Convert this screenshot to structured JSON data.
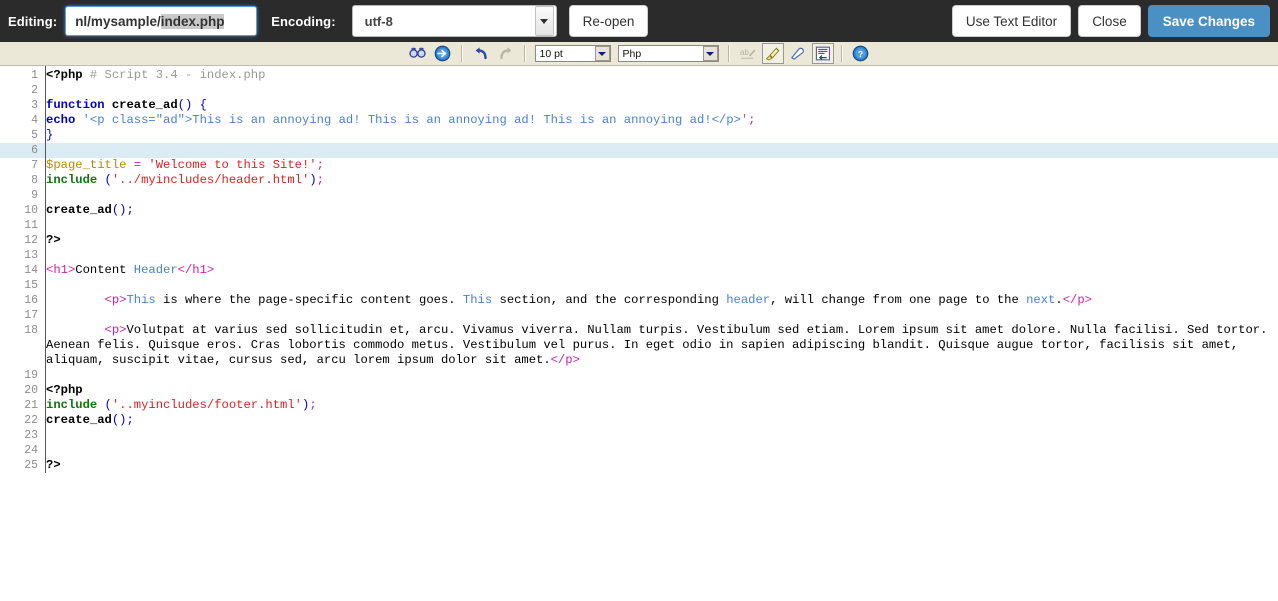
{
  "topbar": {
    "editing_label": "Editing:",
    "filename_prefix": "nl/mysample/",
    "filename_selected": "index.php",
    "encoding_label": "Encoding:",
    "encoding_value": "utf-8",
    "reopen_label": "Re-open",
    "use_text_editor_label": "Use Text Editor",
    "close_label": "Close",
    "save_changes_label": "Save Changes",
    "bar_color": "#2b2b2b",
    "primary_color": "#4a90c4"
  },
  "editor_toolbar": {
    "background": "#ebe8d8",
    "font_size_value": "10 pt",
    "language_value": "Php",
    "icons": [
      "find-icon",
      "goto-line-icon",
      "undo-icon",
      "redo-icon",
      "spellcheck-icon",
      "highlight-icon",
      "eraser-icon",
      "wordwrap-icon",
      "help-icon"
    ]
  },
  "editor": {
    "highlighted_line": 6,
    "total_lines": 25,
    "lines": [
      {
        "n": 1
      },
      {
        "n": 2
      },
      {
        "n": 3
      },
      {
        "n": 4
      },
      {
        "n": 5
      },
      {
        "n": 6
      },
      {
        "n": 7
      },
      {
        "n": 8
      },
      {
        "n": 9
      },
      {
        "n": 10
      },
      {
        "n": 11
      },
      {
        "n": 12
      },
      {
        "n": 13
      },
      {
        "n": 14
      },
      {
        "n": 15
      },
      {
        "n": 16
      },
      {
        "n": 17
      },
      {
        "n": 18
      },
      {
        "n": 19
      },
      {
        "n": 20
      },
      {
        "n": 21
      },
      {
        "n": 22
      },
      {
        "n": 23
      },
      {
        "n": 24
      },
      {
        "n": 25
      }
    ],
    "text": {
      "l1_open": "<?php",
      "l1_comment": " # Script 3.4 - index.php",
      "l3_kw": "function",
      "l3_name": " create_ad",
      "l3_punct": "() {",
      "l4_kw": "echo",
      "l4_str1": " '<p class=\"ad\">",
      "l4_str2": "This is an annoying ad! This is an annoying ad! This is an annoying ad!</p>",
      "l4_str3": "'",
      "l4_semi": ";",
      "l5": "}",
      "l7_var": "$page_title",
      "l7_op": " = ",
      "l7_str": "'Welcome to this Site!'",
      "l7_semi": ";",
      "l8_inc": "include",
      "l8_paren1": " (",
      "l8_str": "'../myincludes/header.html'",
      "l8_paren2": ")",
      "l8_semi": ";",
      "l10_name": "create_ad",
      "l10_punct": "();",
      "l12": "?>",
      "l14_t1": "<h1>",
      "l14_black": "Content ",
      "l14_blue": "Header",
      "l14_t2": "</h1>",
      "l16_indent": "        ",
      "l16_ptag": "<p>",
      "l16_w1": "This",
      "l16_a": " is where the page-specific content goes. ",
      "l16_w2": "This",
      "l16_b": " section, and the corresponding ",
      "l16_w3": "header",
      "l16_c": ", will change from one page to the ",
      "l16_w4": "next",
      "l16_d": ".",
      "l16_pclose": "</p>",
      "l18_indent": "        ",
      "l18_ptag": "<p>",
      "l18_body": "Volutpat at varius sed sollicitudin et, arcu. Vivamus viverra. Nullam turpis. Vestibulum sed etiam. Lorem ipsum sit amet dolore. Nulla facilisi. Sed tortor. Aenean felis. Quisque eros. Cras lobortis commodo metus. Vestibulum vel purus. In eget odio in sapien adipiscing blandit. Quisque augue tortor, facilisis sit amet, aliquam, suscipit vitae, cursus sed, arcu lorem ipsum dolor sit amet.",
      "l18_pclose": "</p>",
      "l20": "<?php",
      "l21_inc": "include",
      "l21_paren1": " (",
      "l21_str": "'..myincludes/footer.html'",
      "l21_paren2": ")",
      "l21_semi": ";",
      "l22_name": "create_ad",
      "l22_punct": "();",
      "l25": "?>"
    }
  }
}
